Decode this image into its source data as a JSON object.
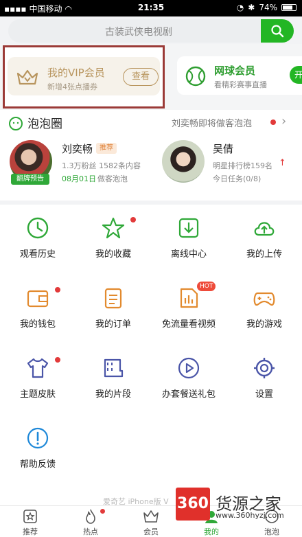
{
  "status_bar": {
    "carrier": "中国移动",
    "time": "21:35",
    "battery": "74%"
  },
  "search": {
    "placeholder": "古装武侠电视剧"
  },
  "vip_card": {
    "title": "我的VIP会员",
    "subtitle": "新增4张点播券",
    "button": "查看"
  },
  "tennis_card": {
    "title": "网球会员",
    "subtitle": "看精彩赛事直播",
    "button": "开"
  },
  "pao": {
    "title": "泡泡圈",
    "news": "刘奕畅即将做客泡泡",
    "stars": [
      {
        "name": "刘奕畅",
        "tag": "推荐",
        "stats": "1.3万粉丝 1582条内容",
        "date": "08月01日",
        "note": "做客泡泡",
        "badge": "翻牌预告"
      },
      {
        "name": "吴倩",
        "rank": "明星排行榜159名",
        "task": "今日任务(0/8)"
      }
    ]
  },
  "grid": {
    "items": [
      {
        "label": "观看历史",
        "icon": "history-clock-icon"
      },
      {
        "label": "我的收藏",
        "icon": "star-icon"
      },
      {
        "label": "离线中心",
        "icon": "download-icon"
      },
      {
        "label": "我的上传",
        "icon": "cloud-upload-icon"
      },
      {
        "label": "我的钱包",
        "icon": "wallet-icon"
      },
      {
        "label": "我的订单",
        "icon": "order-icon"
      },
      {
        "label": "免流量看视频",
        "icon": "sim-card-icon",
        "badge": "HOT"
      },
      {
        "label": "我的游戏",
        "icon": "gamepad-icon"
      },
      {
        "label": "主题皮肤",
        "icon": "tshirt-icon"
      },
      {
        "label": "我的片段",
        "icon": "film-clip-icon"
      },
      {
        "label": "办套餐送礼包",
        "icon": "play-circle-icon"
      },
      {
        "label": "设置",
        "icon": "gear-icon"
      },
      {
        "label": "帮助反馈",
        "icon": "help-icon"
      }
    ]
  },
  "footer_text": "爱奇艺 iPhone版 V",
  "tabbar": [
    {
      "label": "推荐",
      "icon": "star-box-icon"
    },
    {
      "label": "热点",
      "icon": "flame-icon"
    },
    {
      "label": "会员",
      "icon": "crown-icon"
    },
    {
      "label": "我的",
      "icon": "me-icon"
    },
    {
      "label": "泡泡",
      "icon": "bubble-icon"
    }
  ],
  "watermark": {
    "logo": "360",
    "name": "货源之家",
    "url": "www.360hyzj.com"
  },
  "colors": {
    "brand_green": "#23b624",
    "vip_gold": "#b8955e",
    "badge_red": "#e23a3a"
  }
}
